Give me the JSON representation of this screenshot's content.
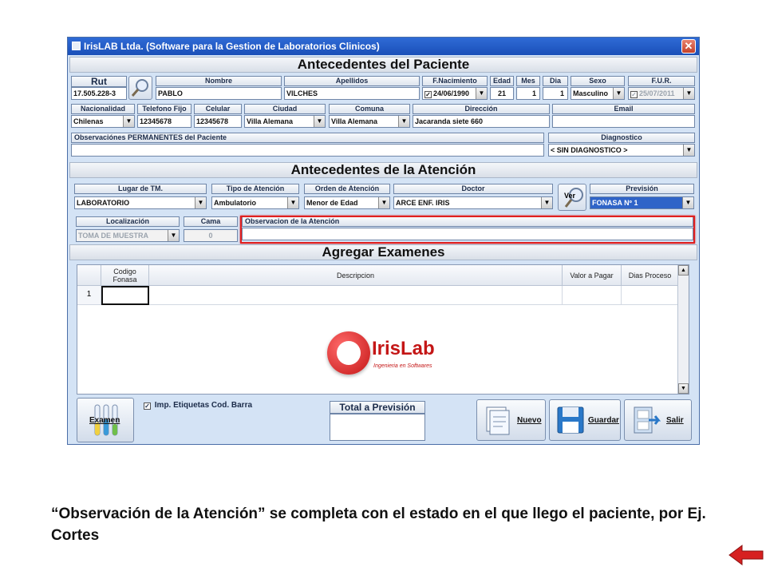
{
  "window": {
    "title": "IrisLAB Ltda. (Software para la Gestion de Laboratorios Clinicos)",
    "close_glyph": "✕"
  },
  "patient": {
    "header": "Antecedentes del Paciente",
    "rut_label": "Rut",
    "rut": "17.505.228-3",
    "nombre_label": "Nombre",
    "nombre": "PABLO",
    "apellidos_label": "Apellidos",
    "apellidos": "VILCHES",
    "fnac_label": "F.Nacimiento",
    "fnac": "24/06/1990",
    "edad_label": "Edad",
    "edad": "21",
    "mes_label": "Mes",
    "mes": "1",
    "dia_label": "Dia",
    "dia": "1",
    "sexo_label": "Sexo",
    "sexo": "Masculino",
    "fur_label": "F.U.R.",
    "fur": "25/07/2011",
    "nacionalidad_label": "Nacionalidad",
    "nacionalidad": "Chilenas",
    "telefono_label": "Telefono Fijo",
    "telefono": "12345678",
    "celular_label": "Celular",
    "celular": "12345678",
    "ciudad_label": "Ciudad",
    "ciudad": "Villa Alemana",
    "comuna_label": "Comuna",
    "comuna": "Villa Alemana",
    "direccion_label": "Dirección",
    "direccion": "Jacaranda siete 660",
    "email_label": "Email",
    "email": "",
    "observaciones_label": "Observaciónes PERMANENTES del Paciente",
    "observaciones": "",
    "diagnostico_label": "Diagnostico",
    "diagnostico": "< SIN DIAGNOSTICO >"
  },
  "attention": {
    "header": "Antecedentes de la Atención",
    "lugar_label": "Lugar de TM.",
    "lugar": "LABORATORIO",
    "tipo_label": "Tipo de Atención",
    "tipo": "Ambulatorio",
    "orden_label": "Orden de Atención",
    "orden": "Menor de Edad",
    "doctor_label": "Doctor",
    "doctor": "ARCE ENF. IRIS",
    "ver_label": "Ver",
    "prevision_label": "Previsión",
    "prevision": "FONASA Nº 1",
    "localizacion_label": "Localización",
    "localizacion": "TOMA DE MUESTRA",
    "cama_label": "Cama",
    "cama": "0",
    "observacion_label": "Observacion de la Atención",
    "observacion": ""
  },
  "exams": {
    "header": "Agregar Examenes",
    "columns": [
      "Codigo Fonasa",
      "Descripcion",
      "Valor a Pagar",
      "Dias Proceso"
    ],
    "rows": [
      {
        "num": "1",
        "codigo": "",
        "descripcion": "",
        "valor": "",
        "dias": ""
      }
    ],
    "logo_text": "IrisLab",
    "logo_tagline": "Ingenieria en Softwares"
  },
  "footer": {
    "examen_label": "Examen",
    "etiquetas_label": "Imp. Etiquetas Cod. Barra",
    "etiquetas_checked": "✓",
    "total_label": "Total a Previsión",
    "total_value": "",
    "nuevo_label": "Nuevo",
    "guardar_label": "Guardar",
    "salir_label": "Salir"
  },
  "caption": "“Observación de la Atención” se completa con el estado en el que llego el paciente, por Ej. Cortes",
  "colors": {
    "highlight": "#e02020",
    "accent": "#2f64c8",
    "titlebar": "#1f56c2"
  }
}
